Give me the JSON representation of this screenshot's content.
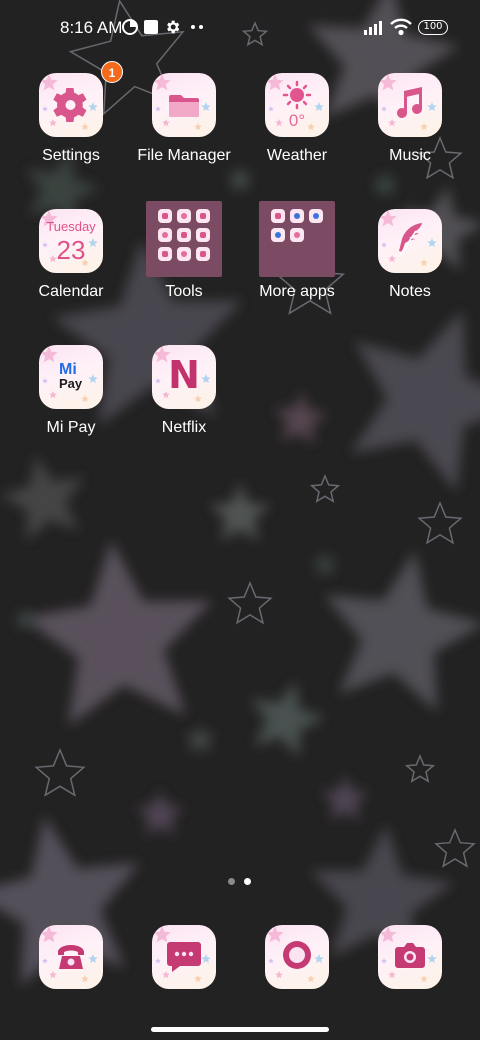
{
  "status_bar": {
    "time": "8:16 AM",
    "battery": "100",
    "icons": [
      "notification-app-icon",
      "square-notification-icon",
      "gear-icon",
      "more-dots-icon",
      "signal-icon",
      "wifi-icon",
      "battery-icon"
    ]
  },
  "apps": {
    "settings": {
      "label": "Settings",
      "badge": "1",
      "icon": "gear-icon"
    },
    "file_manager": {
      "label": "File Manager",
      "icon": "folder-icon"
    },
    "weather": {
      "label": "Weather",
      "temp": "0°",
      "icon": "sun-icon"
    },
    "music": {
      "label": "Music",
      "icon": "music-note-icon"
    },
    "calendar": {
      "label": "Calendar",
      "day": "Tuesday",
      "date": "23",
      "icon": "calendar-icon"
    },
    "tools": {
      "label": "Tools",
      "icon": "folder-grid-icon"
    },
    "more_apps": {
      "label": "More apps",
      "icon": "folder-grid-icon"
    },
    "notes": {
      "label": "Notes",
      "icon": "feather-icon"
    },
    "mi_pay": {
      "label": "Mi Pay",
      "mi": "Mi",
      "pay": "Pay",
      "icon": "mi-pay-icon"
    },
    "netflix": {
      "label": "Netflix",
      "letter": "N",
      "icon": "netflix-icon"
    }
  },
  "dock": [
    {
      "name": "phone",
      "icon": "phone-icon"
    },
    {
      "name": "messages",
      "icon": "chat-bubble-icon"
    },
    {
      "name": "browser",
      "icon": "ring-icon"
    },
    {
      "name": "camera",
      "icon": "camera-icon"
    }
  ],
  "page_indicator": {
    "pages": 2,
    "current": 2
  },
  "colors": {
    "background": "#232222",
    "icon_pink": "#d9568c",
    "badge": "#f36a1d",
    "folder": "#7a4b62"
  }
}
